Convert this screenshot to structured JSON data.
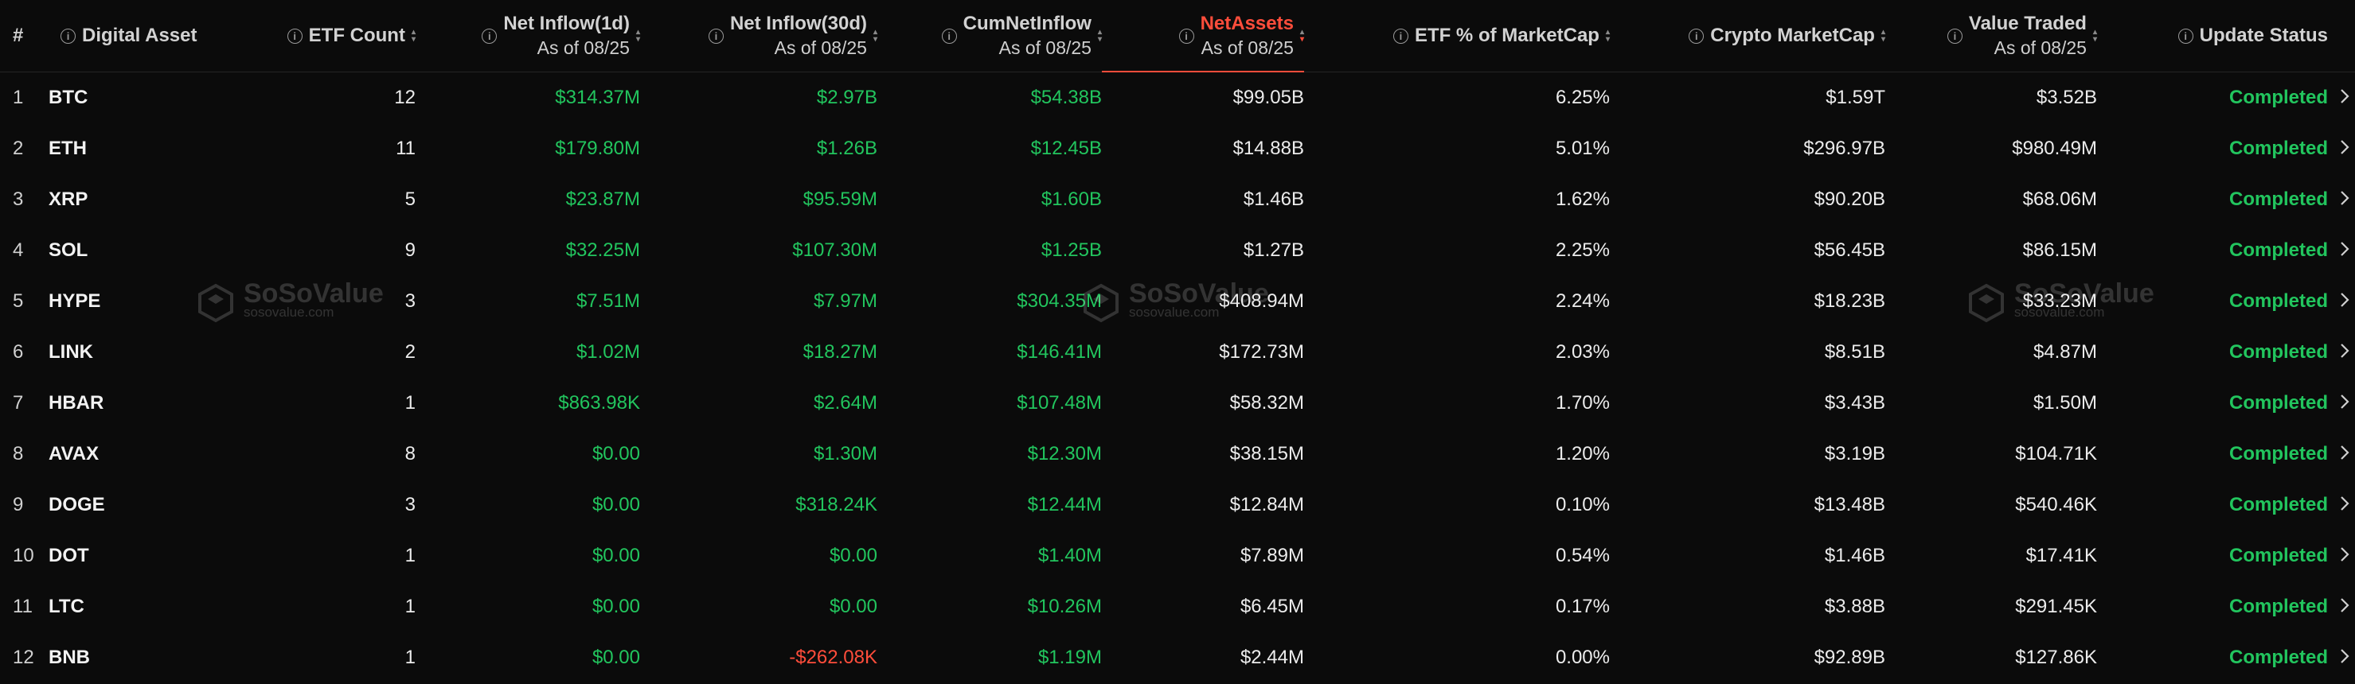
{
  "headers": {
    "rank": "#",
    "asset": "Digital Asset",
    "etf_count": "ETF Count",
    "inflow_1d": {
      "title": "Net Inflow(1d)",
      "sub": "As of 08/25"
    },
    "inflow_30d": {
      "title": "Net Inflow(30d)",
      "sub": "As of 08/25"
    },
    "cum_inflow": {
      "title": "CumNetInflow",
      "sub": "As of 08/25"
    },
    "net_assets": {
      "title": "NetAssets",
      "sub": "As of 08/25"
    },
    "etf_pct": "ETF % of MarketCap",
    "crypto_mcap": "Crypto MarketCap",
    "value_traded": {
      "title": "Value Traded",
      "sub": "As of 08/25"
    },
    "update_status": "Update Status"
  },
  "icons": {
    "info": "info-icon",
    "sort": "sort-icon",
    "row_action": "chevron-right-icon",
    "watermark": "sosovalue-logo"
  },
  "colors": {
    "positive": "#22c55e",
    "negative": "#ff4d3b",
    "active_sort": "#ff4d3b",
    "background": "#0b0b0b"
  },
  "active_sort_column": "NetAssets",
  "watermark": {
    "name": "SoSoValue",
    "url": "sosovalue.com"
  },
  "rows": [
    {
      "rank": "1",
      "symbol": "BTC",
      "etf_count": "12",
      "inflow_1d": "$314.37M",
      "inflow_30d": "$2.97B",
      "cum_inflow": "$54.38B",
      "net_assets": "$99.05B",
      "etf_pct": "6.25%",
      "crypto_mcap": "$1.59T",
      "value_traded": "$3.52B",
      "status": "Completed"
    },
    {
      "rank": "2",
      "symbol": "ETH",
      "etf_count": "11",
      "inflow_1d": "$179.80M",
      "inflow_30d": "$1.26B",
      "cum_inflow": "$12.45B",
      "net_assets": "$14.88B",
      "etf_pct": "5.01%",
      "crypto_mcap": "$296.97B",
      "value_traded": "$980.49M",
      "status": "Completed"
    },
    {
      "rank": "3",
      "symbol": "XRP",
      "etf_count": "5",
      "inflow_1d": "$23.87M",
      "inflow_30d": "$95.59M",
      "cum_inflow": "$1.60B",
      "net_assets": "$1.46B",
      "etf_pct": "1.62%",
      "crypto_mcap": "$90.20B",
      "value_traded": "$68.06M",
      "status": "Completed"
    },
    {
      "rank": "4",
      "symbol": "SOL",
      "etf_count": "9",
      "inflow_1d": "$32.25M",
      "inflow_30d": "$107.30M",
      "cum_inflow": "$1.25B",
      "net_assets": "$1.27B",
      "etf_pct": "2.25%",
      "crypto_mcap": "$56.45B",
      "value_traded": "$86.15M",
      "status": "Completed"
    },
    {
      "rank": "5",
      "symbol": "HYPE",
      "etf_count": "3",
      "inflow_1d": "$7.51M",
      "inflow_30d": "$7.97M",
      "cum_inflow": "$304.35M",
      "net_assets": "$408.94M",
      "etf_pct": "2.24%",
      "crypto_mcap": "$18.23B",
      "value_traded": "$33.23M",
      "status": "Completed"
    },
    {
      "rank": "6",
      "symbol": "LINK",
      "etf_count": "2",
      "inflow_1d": "$1.02M",
      "inflow_30d": "$18.27M",
      "cum_inflow": "$146.41M",
      "net_assets": "$172.73M",
      "etf_pct": "2.03%",
      "crypto_mcap": "$8.51B",
      "value_traded": "$4.87M",
      "status": "Completed"
    },
    {
      "rank": "7",
      "symbol": "HBAR",
      "etf_count": "1",
      "inflow_1d": "$863.98K",
      "inflow_30d": "$2.64M",
      "cum_inflow": "$107.48M",
      "net_assets": "$58.32M",
      "etf_pct": "1.70%",
      "crypto_mcap": "$3.43B",
      "value_traded": "$1.50M",
      "status": "Completed"
    },
    {
      "rank": "8",
      "symbol": "AVAX",
      "etf_count": "8",
      "inflow_1d": "$0.00",
      "inflow_30d": "$1.30M",
      "cum_inflow": "$12.30M",
      "net_assets": "$38.15M",
      "etf_pct": "1.20%",
      "crypto_mcap": "$3.19B",
      "value_traded": "$104.71K",
      "status": "Completed"
    },
    {
      "rank": "9",
      "symbol": "DOGE",
      "etf_count": "3",
      "inflow_1d": "$0.00",
      "inflow_30d": "$318.24K",
      "cum_inflow": "$12.44M",
      "net_assets": "$12.84M",
      "etf_pct": "0.10%",
      "crypto_mcap": "$13.48B",
      "value_traded": "$540.46K",
      "status": "Completed"
    },
    {
      "rank": "10",
      "symbol": "DOT",
      "etf_count": "1",
      "inflow_1d": "$0.00",
      "inflow_30d": "$0.00",
      "cum_inflow": "$1.40M",
      "net_assets": "$7.89M",
      "etf_pct": "0.54%",
      "crypto_mcap": "$1.46B",
      "value_traded": "$17.41K",
      "status": "Completed"
    },
    {
      "rank": "11",
      "symbol": "LTC",
      "etf_count": "1",
      "inflow_1d": "$0.00",
      "inflow_30d": "$0.00",
      "cum_inflow": "$10.26M",
      "net_assets": "$6.45M",
      "etf_pct": "0.17%",
      "crypto_mcap": "$3.88B",
      "value_traded": "$291.45K",
      "status": "Completed"
    },
    {
      "rank": "12",
      "symbol": "BNB",
      "etf_count": "1",
      "inflow_1d": "$0.00",
      "inflow_30d": "-$262.08K",
      "cum_inflow": "$1.19M",
      "net_assets": "$2.44M",
      "etf_pct": "0.00%",
      "crypto_mcap": "$92.89B",
      "value_traded": "$127.86K",
      "status": "Completed"
    }
  ]
}
